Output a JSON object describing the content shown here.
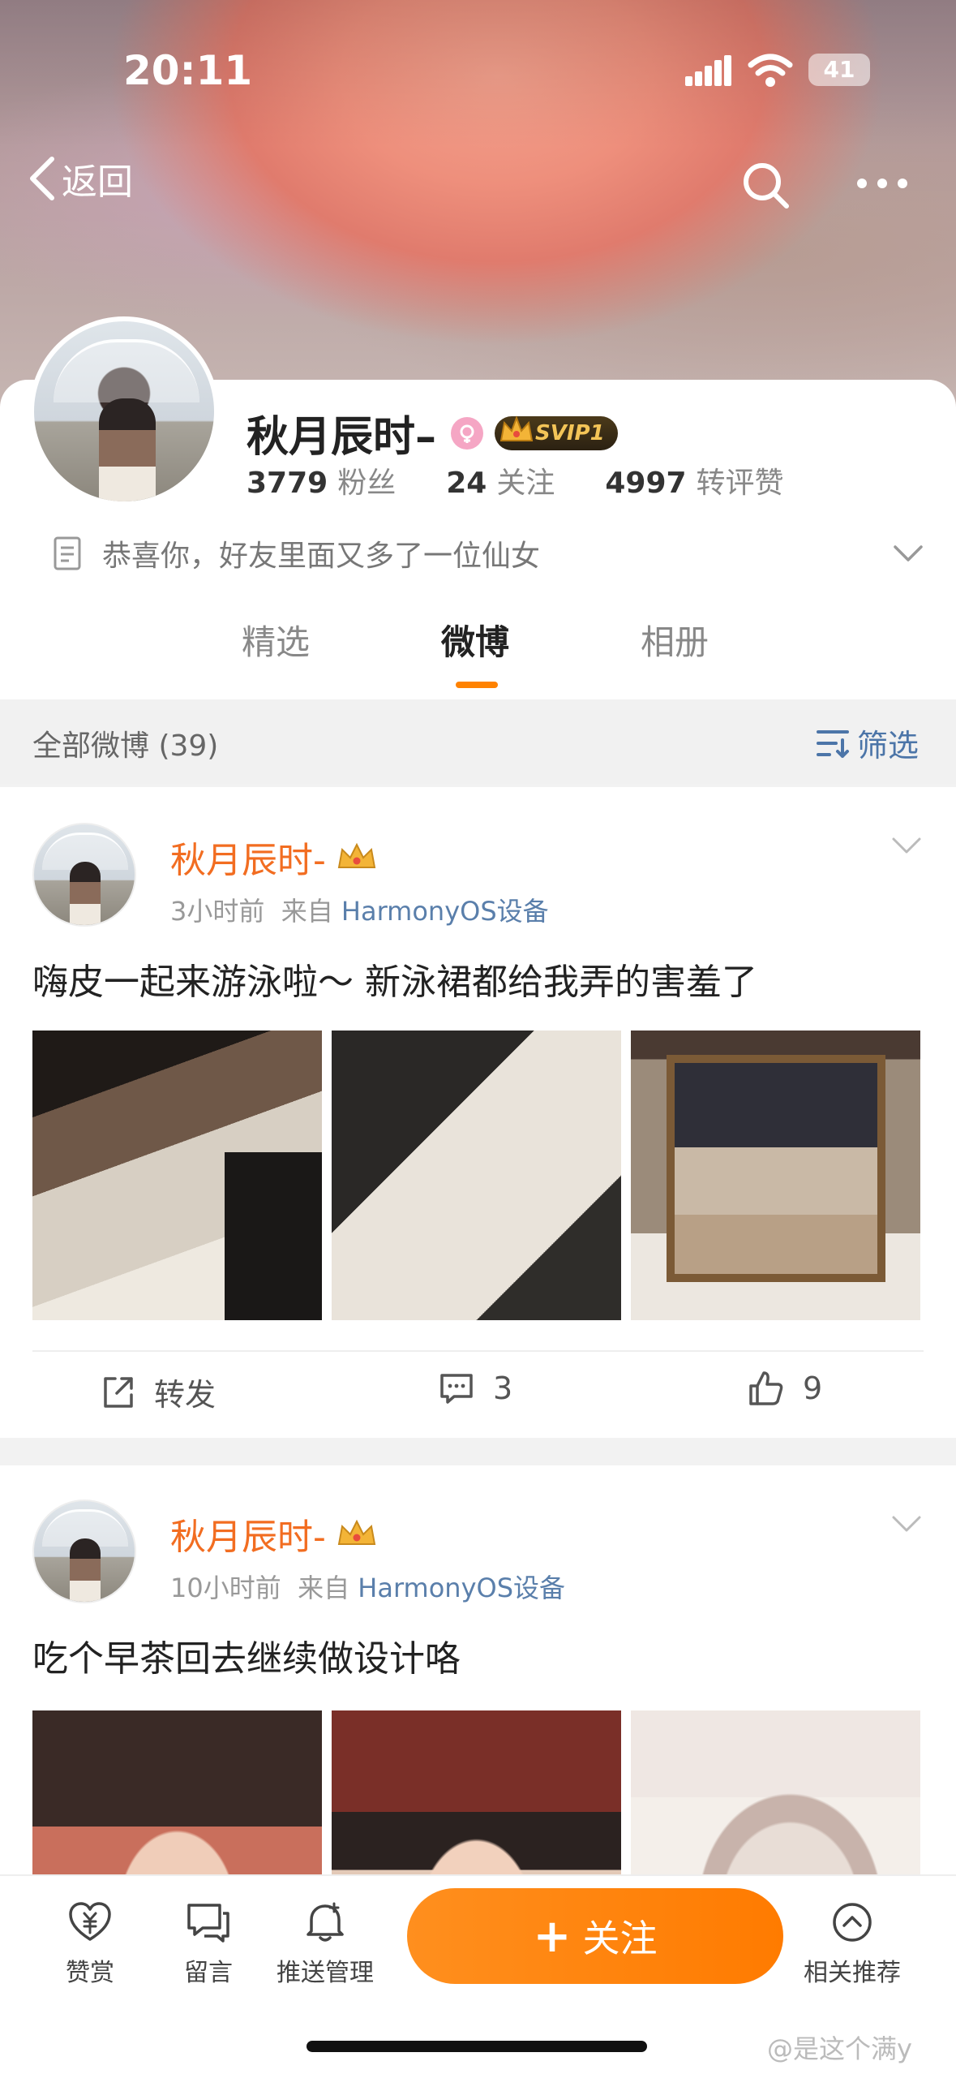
{
  "status": {
    "time": "20:11",
    "battery": "41"
  },
  "nav": {
    "back_label": "返回"
  },
  "profile": {
    "name": "秋月辰时–",
    "svip": "SVIP1",
    "followers_count": "3779",
    "followers_label": "粉丝",
    "following_count": "24",
    "following_label": "关注",
    "likes_count": "4997",
    "likes_label": "转评赞",
    "bio": "恭喜你，好友里面又多了一位仙女"
  },
  "tabs": [
    {
      "label": "精选"
    },
    {
      "label": "微博"
    },
    {
      "label": "相册"
    }
  ],
  "filterbar": {
    "all_label": "全部微博 (39)",
    "filter_label": "筛选"
  },
  "posts": [
    {
      "author": "秋月辰时-",
      "time": "3小时前",
      "source_prefix": "来自",
      "source": "HarmonyOS设备",
      "text": "嗨皮一起来游泳啦～ 新泳裙都给我弄的害羞了",
      "repost_label": "转发",
      "comment_count": "3",
      "like_count": "9"
    },
    {
      "author": "秋月辰时-",
      "time": "10小时前",
      "source_prefix": "来自",
      "source": "HarmonyOS设备",
      "text": "吃个早茶回去继续做设计咯"
    }
  ],
  "bottombar": {
    "reward": "赞赏",
    "message": "留言",
    "push": "推送管理",
    "follow": "关注",
    "related": "相关推荐"
  },
  "watermark": "@是这个满y"
}
